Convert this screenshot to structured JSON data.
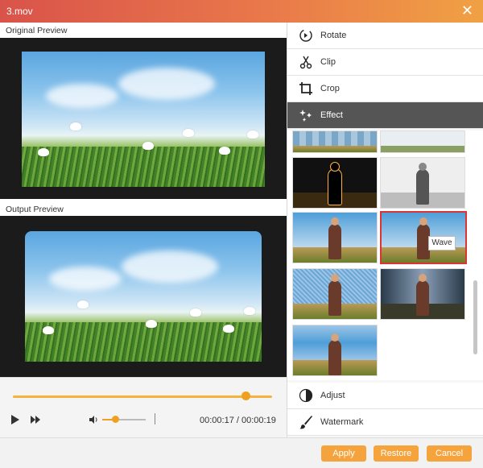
{
  "window": {
    "title": "3.mov",
    "close_glyph": "✕"
  },
  "preview": {
    "original_label": "Original Preview",
    "output_label": "Output Preview"
  },
  "player": {
    "progress": 0.9,
    "volume": 0.3,
    "current_time": "00:00:17",
    "time_separator": "/",
    "total_time": "00:00:19"
  },
  "menu": {
    "rotate": "Rotate",
    "clip": "Clip",
    "crop": "Crop",
    "effect": "Effect",
    "adjust": "Adjust",
    "watermark": "Watermark"
  },
  "effects": {
    "tooltip": "Wave"
  },
  "buttons": {
    "apply": "Apply",
    "restore": "Restore",
    "cancel": "Cancel"
  },
  "colors": {
    "accent": "#f5a33c",
    "selected_border": "#dd3333"
  }
}
